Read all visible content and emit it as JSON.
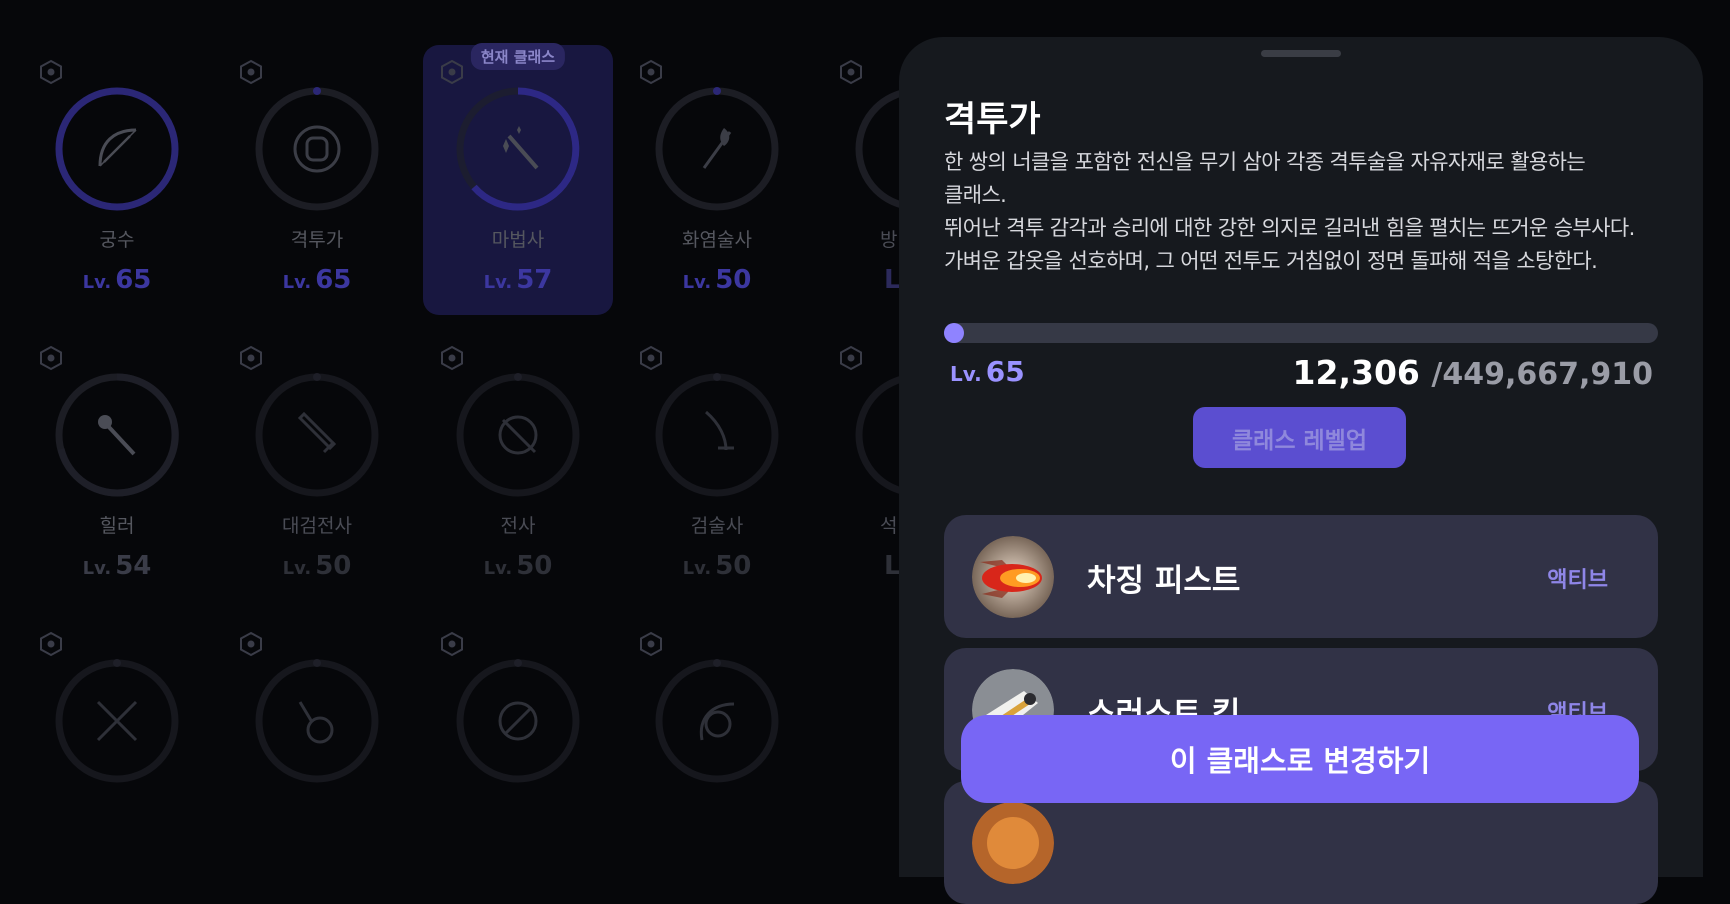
{
  "class_grid": {
    "current_badge": "현재 클래스",
    "level_prefix": "Lv.",
    "classes": [
      {
        "name": "궁수",
        "level": "65",
        "icon": "bow-icon"
      },
      {
        "name": "격투가",
        "level": "65",
        "icon": "fist-icon"
      },
      {
        "name": "마법사",
        "level": "57",
        "icon": "magic-wand-icon"
      },
      {
        "name": "화염술사",
        "level": "50",
        "icon": "flame-staff-icon"
      },
      {
        "name": "힐러",
        "level": "54",
        "icon": "mace-icon"
      },
      {
        "name": "대검전사",
        "level": "50",
        "icon": "greatsword-icon"
      },
      {
        "name": "전사",
        "level": "50",
        "icon": "sword-shield-icon"
      },
      {
        "name": "검술사",
        "level": "50",
        "icon": "saber-icon"
      },
      {
        "name": "",
        "level": "",
        "icon": "crossed-swords-icon"
      },
      {
        "name": "",
        "level": "",
        "icon": "lute-icon"
      },
      {
        "name": "",
        "level": "",
        "icon": "bone-staff-icon"
      },
      {
        "name": "",
        "level": "",
        "icon": "harp-icon"
      }
    ],
    "partial_labels": [
      "방",
      "Lv",
      "석",
      "Lv"
    ]
  },
  "detail": {
    "title": "격투가",
    "description": [
      "한 쌍의 너클을 포함한 전신을 무기 삼아 각종 격투술을 자유자재로 활용하는",
      "클래스.",
      "뛰어난 격투 감각과 승리에 대한 강한 의지로 길러낸 힘을 펼치는 뜨거운 승부사다.",
      "가벼운 갑옷을 선호하며, 그 어떤 전투도 거침없이 정면 돌파해 적을 소탕한다."
    ],
    "level_prefix": "Lv.",
    "level": "65",
    "xp_current": "12,306",
    "xp_total": "/449,667,910",
    "xp_progress": 3e-05,
    "levelup_label": "클래스 레벨업",
    "skills": [
      {
        "name": "차징 피스트",
        "type": "액티브",
        "icon": "flaming-fist-icon"
      },
      {
        "name": "스러스트 킥",
        "type": "액티브",
        "icon": "kick-icon"
      },
      {
        "name": "",
        "type": "",
        "icon": "skill-icon"
      }
    ],
    "change_label": "이 클래스로 변경하기"
  },
  "colors": {
    "accent": "#7866f5",
    "level_text": "#9a92ff",
    "sheet_bg": "#16191e",
    "backdrop": "#06070a"
  }
}
